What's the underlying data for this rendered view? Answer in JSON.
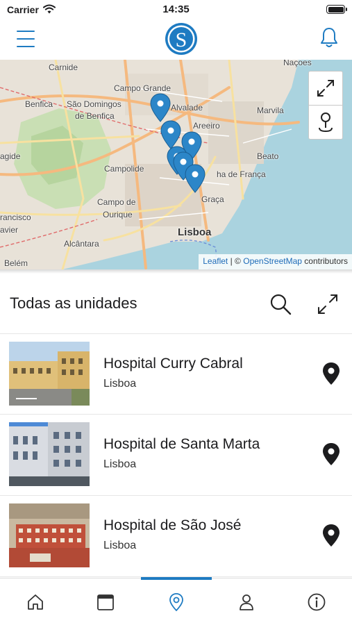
{
  "status_bar": {
    "carrier": "Carrier",
    "time": "14:35"
  },
  "header": {
    "logo_letter": "S",
    "menu_icon": "hamburger-icon",
    "notification_icon": "bell-icon"
  },
  "map": {
    "labels": [
      "Carnide",
      "Campo Grande",
      "Naçoes",
      "Benfica",
      "São Domingos",
      "de Benfica",
      "Alvalade",
      "Marvila",
      "Areeiro",
      "Beato",
      "Campolide",
      "ha de França",
      "Campo de",
      "Ourique",
      "Graça",
      "Lisboa",
      "Alcântara",
      "rancisco",
      "avier",
      "agide",
      "Belém"
    ],
    "attribution": {
      "leaflet": "Leaflet",
      "separator": "| ©",
      "osm": "OpenStreetMap",
      "suffix": "contributors"
    },
    "controls": [
      "fullscreen-icon",
      "locate-pin-icon"
    ],
    "marker_count": 7
  },
  "section": {
    "title": "Todas as unidades",
    "search_icon": "search-icon",
    "expand_icon": "expand-icon"
  },
  "units": [
    {
      "name": "Hospital Curry Cabral",
      "city": "Lisboa"
    },
    {
      "name": "Hospital de Santa Marta",
      "city": "Lisboa"
    },
    {
      "name": "Hospital de São José",
      "city": "Lisboa"
    }
  ],
  "tab_bar": {
    "tabs": [
      "home-icon",
      "calendar-icon",
      "location-icon",
      "user-icon",
      "info-icon"
    ],
    "active_index": 2
  },
  "colors": {
    "accent": "#1e7bc2",
    "marker": "#2c86c8",
    "water": "#aad3df"
  }
}
